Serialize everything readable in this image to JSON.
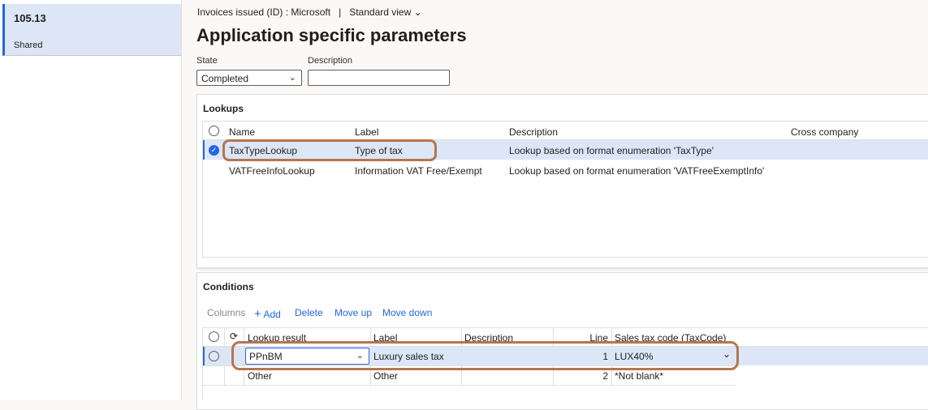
{
  "sidebar": {
    "item_title": "105.13",
    "item_subtitle": "Shared"
  },
  "header": {
    "breadcrumb": "Invoices issued (ID) : Microsoft",
    "separator": "|",
    "view": "Standard view",
    "title": "Application specific parameters"
  },
  "form": {
    "state_label": "State",
    "state_value": "Completed",
    "description_label": "Description",
    "description_value": ""
  },
  "lookups": {
    "title": "Lookups",
    "columns": [
      "Name",
      "Label",
      "Description",
      "Cross company"
    ],
    "rows": [
      {
        "name": "TaxTypeLookup",
        "label": "Type of tax",
        "description": "Lookup based on format enumeration 'TaxType'",
        "cross_company": "",
        "selected": true
      },
      {
        "name": "VATFreeInfoLookup",
        "label": "Information VAT Free/Exempt",
        "description": "Lookup based on format enumeration 'VATFreeExemptInfo'",
        "cross_company": "",
        "selected": false
      }
    ]
  },
  "conditions": {
    "title": "Conditions",
    "toolbar": {
      "columns": "Columns",
      "add": "Add",
      "delete": "Delete",
      "move_up": "Move up",
      "move_down": "Move down"
    },
    "columns": [
      "Lookup result",
      "Label",
      "Description",
      "Line",
      "Sales tax code (TaxCode)"
    ],
    "rows": [
      {
        "lookup_result": "PPnBM",
        "label": "Luxury sales tax",
        "description": "",
        "line": "1",
        "tax_code": "LUX40%"
      },
      {
        "lookup_result": "Other",
        "label": "Other",
        "description": "",
        "line": "2",
        "tax_code": "*Not blank*"
      }
    ]
  },
  "colors": {
    "accent": "#2266e3",
    "selection": "#dce6f7",
    "annotation": "#b5764f"
  }
}
